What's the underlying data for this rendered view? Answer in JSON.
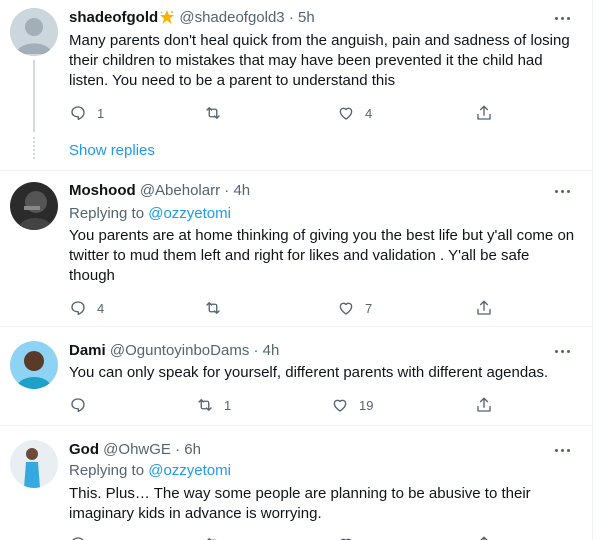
{
  "replies": [
    {
      "name": "shadeofgold",
      "handle": "@shadeofgold3",
      "time": "· 5h",
      "text": "Many parents don't  heal quick from the anguish, pain and sadness of losing their children to mistakes that may have been prevented it the child had listen. You need to be a parent to understand this",
      "reply_count": "1",
      "retweet_count": "",
      "like_count": "4",
      "show_replies": "Show replies"
    },
    {
      "name": "Moshood",
      "handle": "@Abeholarr",
      "time": "· 4h",
      "replying_label": "Replying to",
      "replying_to": "@ozzyetomi",
      "text": "You parents are at home thinking of giving you the best life but y'all come on twitter to mud them left and right for likes and validation . Y'all be safe though",
      "reply_count": "4",
      "retweet_count": "",
      "like_count": "7"
    },
    {
      "name": "Dami",
      "handle": "@OguntoyinboDams",
      "time": "· 4h",
      "text": "You can only speak for yourself, different parents with different agendas.",
      "reply_count": "",
      "retweet_count": "1",
      "like_count": "19"
    },
    {
      "name": "God",
      "handle": "@OhwGE",
      "time": "· 6h",
      "replying_label": "Replying to",
      "replying_to": "@ozzyetomi",
      "text": "This. Plus… The way some people are planning to be abusive to their imaginary kids in advance is worrying."
    }
  ],
  "colors": {
    "link": "#1d9bf0",
    "secondary_text": "#536471",
    "divider": "#eff3f4"
  },
  "icons": [
    "reply-icon",
    "retweet-icon",
    "like-icon",
    "share-icon",
    "more-icon",
    "star-emoji-icon"
  ]
}
